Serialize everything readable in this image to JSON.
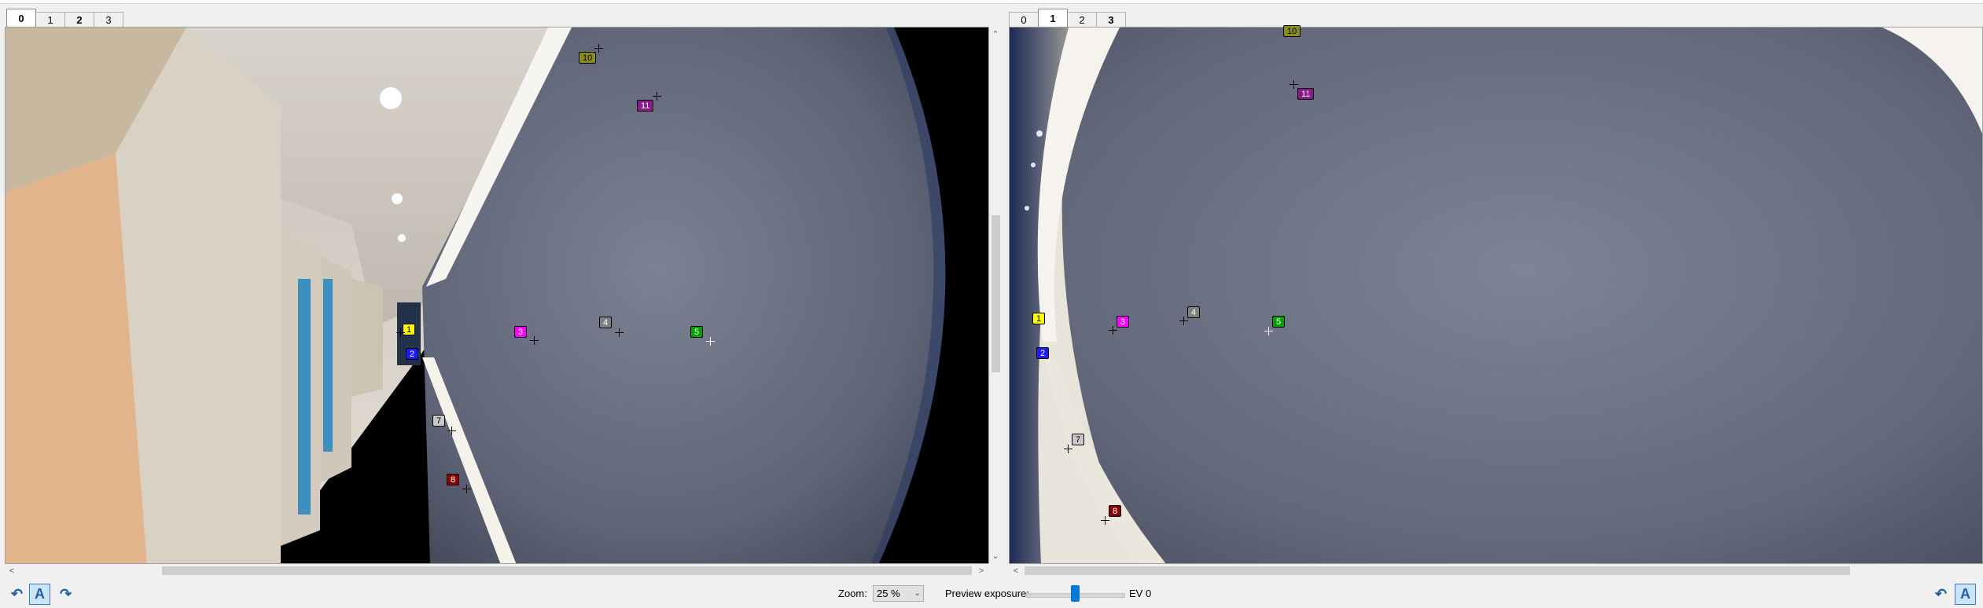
{
  "left_panel": {
    "tabs": [
      "0",
      "1",
      "2",
      "3"
    ],
    "active_tab": "0",
    "control_points": [
      {
        "id": "10",
        "color": "#8c8c1c",
        "text_color": "#000000"
      },
      {
        "id": "11",
        "color": "#8b1a8b",
        "text_color": "#ffffff"
      },
      {
        "id": "3",
        "color": "#ff00ff",
        "text_color": "#ffffff"
      },
      {
        "id": "4",
        "color": "#808080",
        "text_color": "#ffffff"
      },
      {
        "id": "5",
        "color": "#00a000",
        "text_color": "#ffffff"
      },
      {
        "id": "1",
        "color": "#ffff00",
        "text_color": "#000000"
      },
      {
        "id": "2",
        "color": "#1a1aff",
        "text_color": "#ffffff"
      },
      {
        "id": "7",
        "color": "#c8c8c8",
        "text_color": "#000000"
      },
      {
        "id": "8",
        "color": "#8b0000",
        "text_color": "#ffffff"
      }
    ]
  },
  "right_panel": {
    "tabs": [
      "0",
      "1",
      "2",
      "3"
    ],
    "active_tab": "1",
    "control_points": [
      {
        "id": "10",
        "color": "#8c8c1c",
        "text_color": "#000000"
      },
      {
        "id": "11",
        "color": "#8b1a8b",
        "text_color": "#ffffff"
      },
      {
        "id": "4",
        "color": "#808080",
        "text_color": "#ffffff"
      },
      {
        "id": "1",
        "color": "#ffff00",
        "text_color": "#000000"
      },
      {
        "id": "3",
        "color": "#ff00ff",
        "text_color": "#ffffff"
      },
      {
        "id": "5",
        "color": "#00a000",
        "text_color": "#ffffff"
      },
      {
        "id": "2",
        "color": "#1a1aff",
        "text_color": "#ffffff"
      },
      {
        "id": "7",
        "color": "#c8c8c8",
        "text_color": "#000000"
      },
      {
        "id": "8",
        "color": "#8b0000",
        "text_color": "#ffffff"
      }
    ]
  },
  "bottom": {
    "auto_label": "A",
    "zoom_label": "Zoom:",
    "zoom_value": "25 %",
    "exposure_label": "Preview exposure:",
    "exposure_value": "EV 0",
    "exposure_level_fraction": 0.5
  },
  "icons": [
    "undo-icon",
    "redo-icon",
    "auto-add-icon",
    "chevron-down-icon"
  ]
}
